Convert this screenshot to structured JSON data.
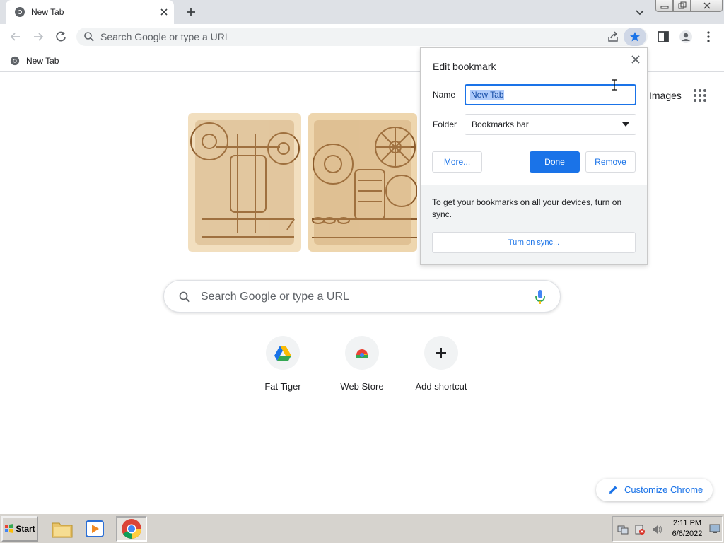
{
  "tab": {
    "title": "New Tab"
  },
  "omnibox": {
    "placeholder": "Search Google or type a URL"
  },
  "bookmarks_bar": {
    "items": [
      {
        "label": "New Tab"
      }
    ]
  },
  "page": {
    "images_link": "Images",
    "search_placeholder": "Search Google or type a URL",
    "shortcuts": [
      {
        "label": "Fat Tiger",
        "icon": "google-drive-icon"
      },
      {
        "label": "Web Store",
        "icon": "chrome-web-store-icon"
      },
      {
        "label": "Add shortcut",
        "icon": "plus-icon"
      }
    ],
    "customize_label": "Customize Chrome"
  },
  "edit_bookmark": {
    "title": "Edit bookmark",
    "name_label": "Name",
    "name_value": "New Tab",
    "folder_label": "Folder",
    "folder_value": "Bookmarks bar",
    "more_label": "More...",
    "done_label": "Done",
    "remove_label": "Remove",
    "sync_text": "To get your bookmarks on all your devices, turn on sync.",
    "sync_button": "Turn on sync..."
  },
  "taskbar": {
    "start_label": "Start",
    "time": "2:11 PM",
    "date": "6/6/2022"
  },
  "colors": {
    "accent": "#1a73e8",
    "tabstrip": "#dee1e6",
    "taskbar": "#d6d3ce"
  }
}
